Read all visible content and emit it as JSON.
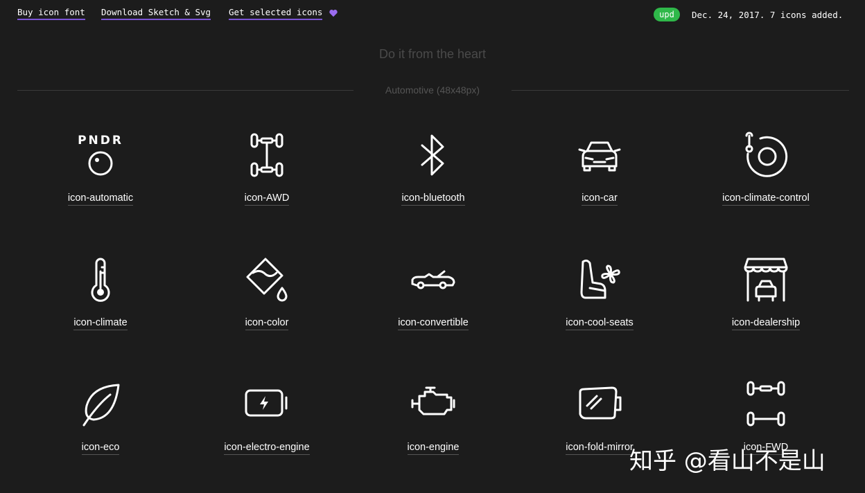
{
  "topbar": {
    "links": [
      {
        "label": "Buy icon font"
      },
      {
        "label": "Download Sketch & Svg"
      },
      {
        "label": "Get selected icons"
      }
    ],
    "update_badge": "upd",
    "update_text": "Dec. 24, 2017. 7 icons added.",
    "accent_color": "#7b55d6",
    "badge_color": "#2fb84a"
  },
  "tagline": "Do it from the heart",
  "section": {
    "title": "Automotive (48x48px)"
  },
  "icons": [
    {
      "name": "icon-automatic",
      "glyph": "gear-shift-icon"
    },
    {
      "name": "icon-AWD",
      "glyph": "awd-axle-icon"
    },
    {
      "name": "icon-bluetooth",
      "glyph": "bluetooth-icon"
    },
    {
      "name": "icon-car",
      "glyph": "car-icon"
    },
    {
      "name": "icon-climate-control",
      "glyph": "climate-control-icon"
    },
    {
      "name": "icon-climate",
      "glyph": "thermometer-icon"
    },
    {
      "name": "icon-color",
      "glyph": "paint-bucket-icon"
    },
    {
      "name": "icon-convertible",
      "glyph": "convertible-car-icon"
    },
    {
      "name": "icon-cool-seats",
      "glyph": "seat-fan-icon"
    },
    {
      "name": "icon-dealership",
      "glyph": "dealership-icon"
    },
    {
      "name": "icon-eco",
      "glyph": "leaf-icon"
    },
    {
      "name": "icon-electro-engine",
      "glyph": "battery-icon"
    },
    {
      "name": "icon-engine",
      "glyph": "engine-icon"
    },
    {
      "name": "icon-fold-mirror",
      "glyph": "mirror-icon"
    },
    {
      "name": "icon-FWD",
      "glyph": "fwd-axle-icon"
    }
  ],
  "watermark": "知乎 @看山不是山"
}
